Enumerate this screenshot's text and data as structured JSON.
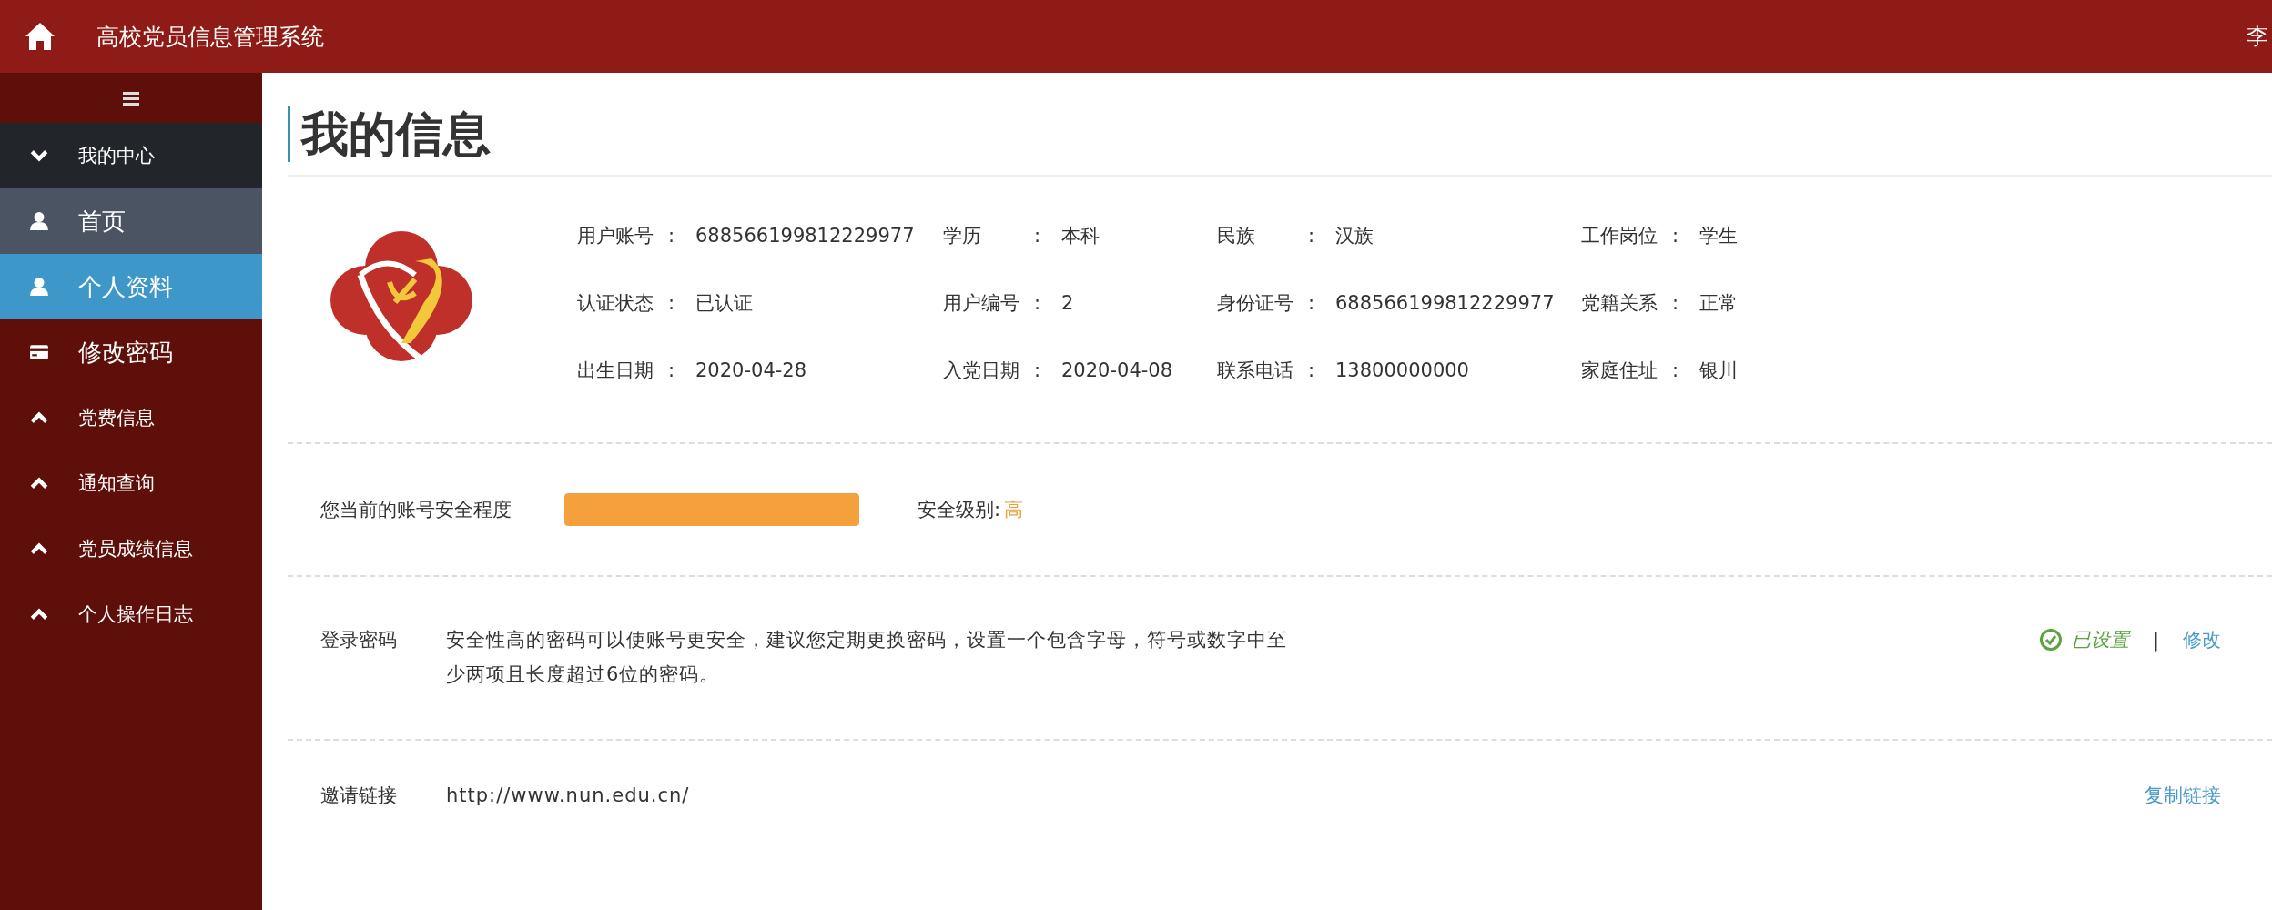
{
  "header": {
    "title": "高校党员信息管理系统",
    "user": "李"
  },
  "sidebar": {
    "groups": [
      {
        "label": "我的中心",
        "expanded": true,
        "children": [
          {
            "label": "首页",
            "kind": "user",
            "selected": false,
            "hovered": true
          },
          {
            "label": "个人资料",
            "kind": "user",
            "selected": true,
            "hovered": false
          },
          {
            "label": "修改密码",
            "kind": "card",
            "selected": false,
            "hovered": false
          }
        ]
      },
      {
        "label": "党费信息",
        "expanded": false
      },
      {
        "label": "通知查询",
        "expanded": false
      },
      {
        "label": "党员成绩信息",
        "expanded": false
      },
      {
        "label": "个人操作日志",
        "expanded": false
      }
    ]
  },
  "page_title": "我的信息",
  "profile_fields": [
    {
      "label": "用户账号",
      "separator": ":",
      "value": "688566199812229977"
    },
    {
      "label": "学历",
      "separator": ":",
      "value": "本科"
    },
    {
      "label": "民族",
      "separator": ":",
      "value": "汉族"
    },
    {
      "label": "工作岗位",
      "separator": ":",
      "value": "学生"
    },
    {
      "label": "认证状态",
      "separator": ":",
      "value": "已认证"
    },
    {
      "label": "用户编号",
      "separator": ":",
      "value": "2"
    },
    {
      "label": "身份证号",
      "separator": ":",
      "value": "688566199812229977"
    },
    {
      "label": "党籍关系",
      "separator": ":",
      "value": "正常"
    },
    {
      "label": "出生日期",
      "separator": ":",
      "value": "2020-04-28"
    },
    {
      "label": "入党日期",
      "separator": ":",
      "value": "2020-04-08"
    },
    {
      "label": "联系电话",
      "separator": ":",
      "value": "13800000000"
    },
    {
      "label": "家庭住址",
      "separator": ":",
      "value": "银川"
    }
  ],
  "security": {
    "label": "您当前的账号安全程度",
    "level": 1,
    "level_label": "安全级别:",
    "level_value": "高"
  },
  "password": {
    "label": "登录密码",
    "description": "安全性高的密码可以使账号更安全，建议您定期更换密码，设置一个包含字母，符号或数字中至少两项且长度超过6位的密码。",
    "status": "已设置",
    "is_set": true,
    "separator": "|",
    "action": "修改"
  },
  "invite": {
    "label": "邀请链接",
    "url": "http://www.nun.edu.cn/",
    "action": "复制链接"
  }
}
